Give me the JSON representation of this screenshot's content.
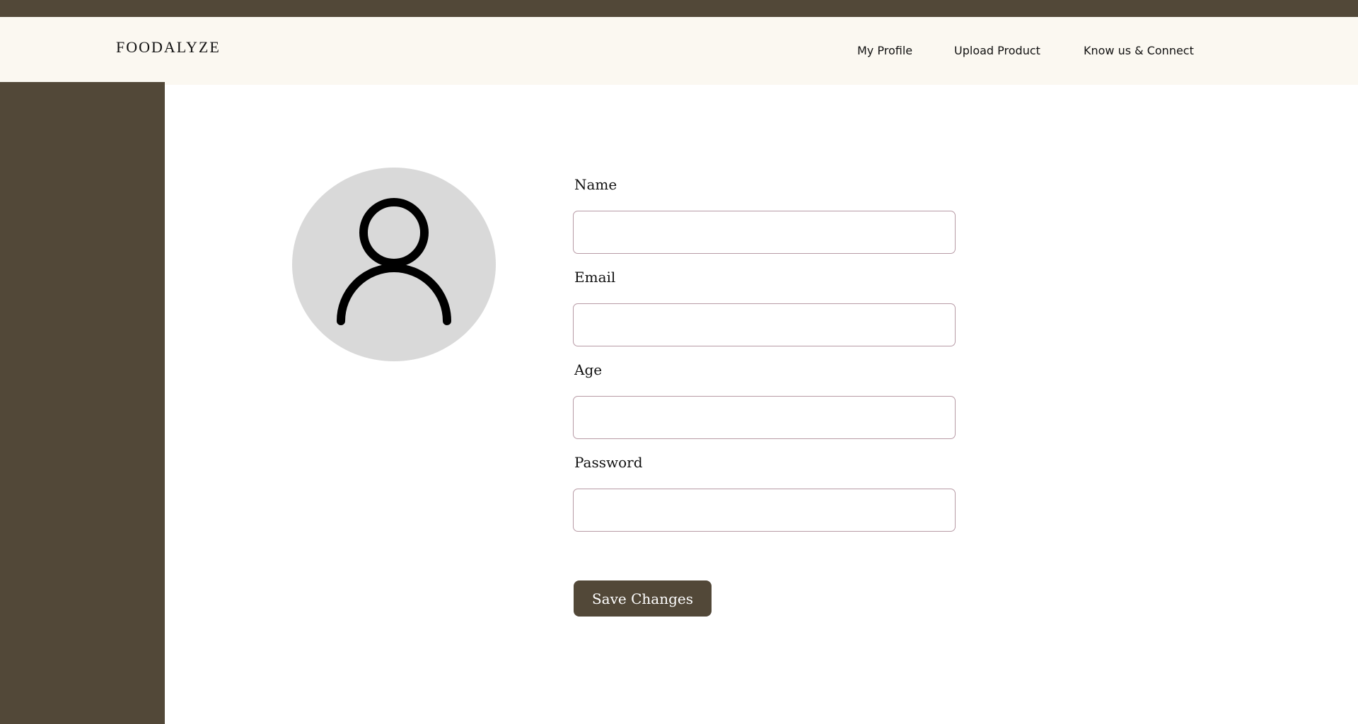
{
  "header": {
    "logo": "FOODALYZE",
    "nav": [
      {
        "label": "My Profile"
      },
      {
        "label": "Upload Product"
      },
      {
        "label": "Know us & Connect"
      }
    ]
  },
  "avatar": {
    "icon": "user-icon"
  },
  "form": {
    "name_label": "Name",
    "name_value": "",
    "email_label": "Email",
    "email_value": "",
    "age_label": "Age",
    "age_value": "",
    "password_label": "Password",
    "password_value": "",
    "save_label": "Save Changes"
  },
  "colors": {
    "brand_dark": "#524838",
    "header_bg": "#fbf8f1",
    "avatar_bg": "#d9d9d9",
    "field_border": "#b79aa5"
  }
}
